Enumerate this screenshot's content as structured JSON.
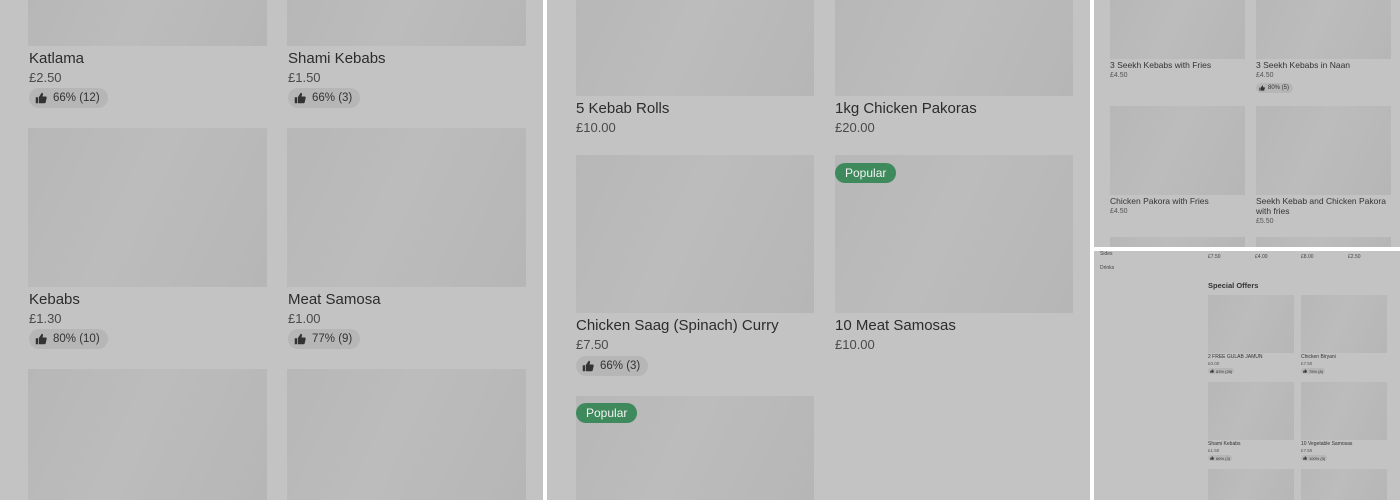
{
  "panel1": {
    "cards": [
      {
        "name": "Katlama",
        "price": "£2.50",
        "rating": "66% (12)"
      },
      {
        "name": "Shami Kebabs",
        "price": "£1.50",
        "rating": "66% (3)"
      },
      {
        "name": "Kebabs",
        "price": "£1.30",
        "rating": "80% (10)"
      },
      {
        "name": "Meat Samosa",
        "price": "£1.00",
        "rating": "77% (9)"
      }
    ]
  },
  "panel2": {
    "cards": [
      {
        "name": "5 Kebab Rolls",
        "price": "£10.00"
      },
      {
        "name": "1kg Chicken Pakoras",
        "price": "£20.00"
      },
      {
        "name": "Chicken Saag (Spinach) Curry",
        "price": "£7.50",
        "rating": "66% (3)"
      },
      {
        "name": "10 Meat Samosas",
        "price": "£10.00",
        "badge": "Popular"
      },
      {
        "badge": "Popular"
      }
    ]
  },
  "panel3": {
    "cards": [
      {
        "name": "3 Seekh Kebabs with Fries",
        "price": "£4.50"
      },
      {
        "name": "3 Seekh Kebabs in Naan",
        "price": "£4.50",
        "rating": "80% (5)"
      },
      {
        "name": "Chicken Pakora with Fries",
        "price": "£4.50"
      },
      {
        "name_line1": "Seekh Kebab and Chicken Pakora",
        "name_line2": "with fries",
        "price": "£5.50"
      }
    ]
  },
  "panel4": {
    "sidebar": [
      "Sides",
      "Drinks"
    ],
    "top_prices": [
      "£7.50",
      "£4.00",
      "£8.00",
      "£2.50"
    ],
    "section_title": "Special Offers",
    "cards": [
      {
        "name": "2 FREE GULAB JAMUN",
        "price": "£0.00",
        "rating": "83% (28)"
      },
      {
        "name": "Chicken Biryani",
        "price": "£7.50",
        "rating": "75% (8)"
      },
      {
        "name": "Shami Kebabs",
        "price": "£1.50",
        "rating": "66% (3)"
      },
      {
        "name": "10 Vegetable Samosas",
        "price": "£7.50",
        "rating": "100% (3)"
      }
    ]
  },
  "colors": {
    "panel_bg": "#c3c3c3",
    "thumb": "#b9b9b9",
    "badge": "#3f8a5c"
  },
  "icons": {
    "rating": "thumbs-up-icon"
  }
}
